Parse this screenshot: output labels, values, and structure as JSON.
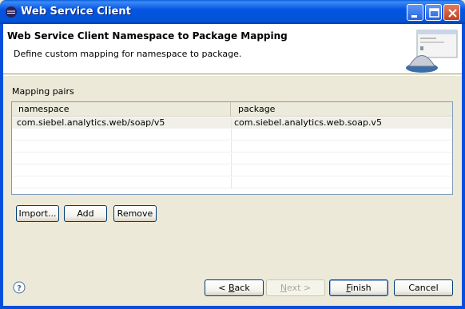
{
  "window": {
    "title": "Web Service Client",
    "controls": [
      "minimize",
      "maximize",
      "close"
    ]
  },
  "banner": {
    "title": "Web Service Client Namespace to Package Mapping",
    "description": "Define custom mapping for namespace to package.",
    "image_icon": "web-service-bell-icon"
  },
  "mapping": {
    "group_label": "Mapping pairs",
    "columns": [
      "namespace",
      "package"
    ],
    "rows": [
      {
        "namespace": "com.siebel.analytics.web/soap/v5",
        "package": "com.siebel.analytics.web.soap.v5"
      }
    ],
    "buttons": {
      "import": "Import...",
      "add": "Add",
      "remove": "Remove"
    }
  },
  "footer": {
    "help_icon": "help-icon",
    "back_prefix": "< ",
    "back_mnemonic": "B",
    "back_rest": "ack",
    "next_mnemonic": "N",
    "next_rest": "ext >",
    "finish_mnemonic": "F",
    "finish_rest": "inish",
    "cancel": "Cancel"
  },
  "colors": {
    "titlebar": "#0554e3",
    "dialog_bg": "#ece9d8",
    "table_border": "#7f9db9"
  }
}
